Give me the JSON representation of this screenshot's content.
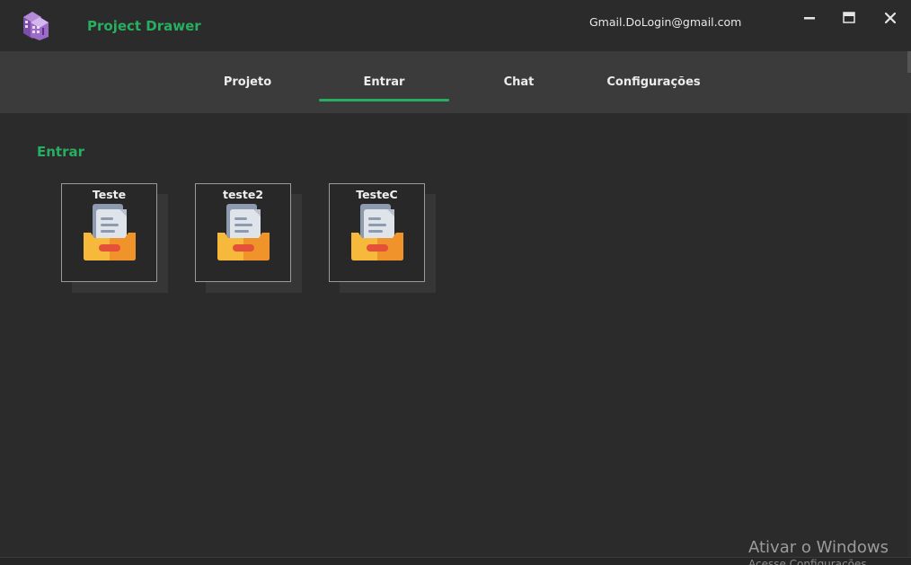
{
  "window": {
    "title": "Project Drawer",
    "user_email": "Gmail.DoLogin@gmail.com",
    "controls": [
      "minimize-icon",
      "maximize-icon",
      "close-icon"
    ]
  },
  "nav": {
    "tabs": [
      {
        "label": "Projeto",
        "active": false
      },
      {
        "label": "Entrar",
        "active": true
      },
      {
        "label": "Chat",
        "active": false
      },
      {
        "label": "Configurações",
        "active": false
      }
    ]
  },
  "main": {
    "section_title": "Entrar",
    "projects": [
      {
        "name": "Teste",
        "icon": "document-tray-icon"
      },
      {
        "name": "teste2",
        "icon": "document-tray-icon"
      },
      {
        "name": "TesteC",
        "icon": "document-tray-icon"
      }
    ]
  },
  "overlay": {
    "watermark": "Ativar o Windows",
    "watermark_sub": "Acesse Configurações"
  },
  "colors": {
    "accent": "#27ae60",
    "background": "#2b2b2b",
    "navbar": "#3c3b3b",
    "folder": "#f6b93b",
    "folder_dark": "#f0932b",
    "document": "#dfe4ea"
  }
}
